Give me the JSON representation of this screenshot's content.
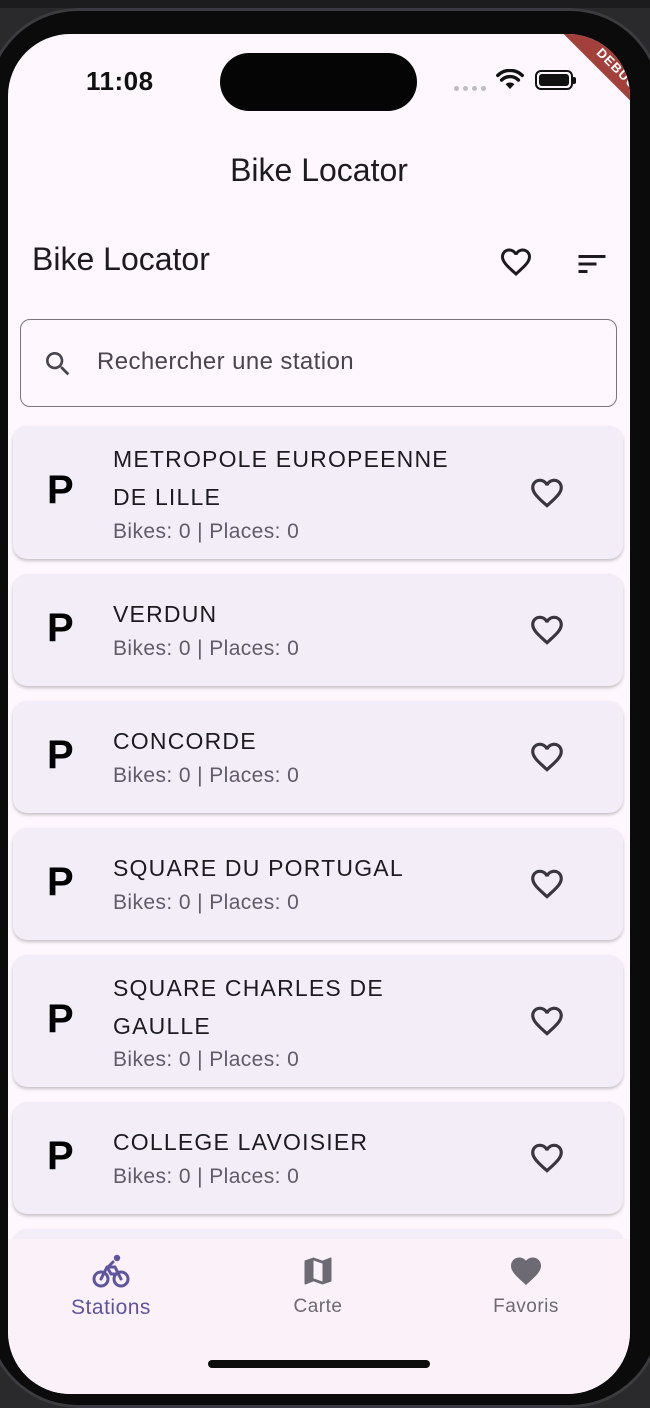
{
  "status_bar": {
    "time": "11:08",
    "debug_label": "DEBUG"
  },
  "app": {
    "title": "Bike Locator"
  },
  "header": {
    "title": "Bike Locator",
    "icons": [
      "favorite-outline-icon",
      "sort-icon"
    ]
  },
  "search": {
    "placeholder": "Rechercher une station",
    "value": ""
  },
  "stations": [
    {
      "name": "METROPOLE EUROPEENNE DE LILLE",
      "info": "Bikes: 0 | Places: 0",
      "marker": "P"
    },
    {
      "name": "VERDUN",
      "info": "Bikes: 0 | Places: 0",
      "marker": "P"
    },
    {
      "name": "CONCORDE",
      "info": "Bikes: 0 | Places: 0",
      "marker": "P"
    },
    {
      "name": "SQUARE DU PORTUGAL",
      "info": "Bikes: 0 | Places: 0",
      "marker": "P"
    },
    {
      "name": "SQUARE CHARLES DE GAULLE",
      "info": "Bikes: 0 | Places: 0",
      "marker": "P"
    },
    {
      "name": "COLLEGE LAVOISIER",
      "info": "Bikes: 0 | Places: 0",
      "marker": "P"
    }
  ],
  "bottom_nav": [
    {
      "label": "Stations",
      "icon": "bike-icon",
      "active": true
    },
    {
      "label": "Carte",
      "icon": "map-icon",
      "active": false
    },
    {
      "label": "Favoris",
      "icon": "heart-filled-icon",
      "active": false
    }
  ],
  "colors": {
    "background": "#fef7fd",
    "card": "#f3edf7",
    "accent": "#5f559e",
    "debug_banner": "#a3403b"
  }
}
